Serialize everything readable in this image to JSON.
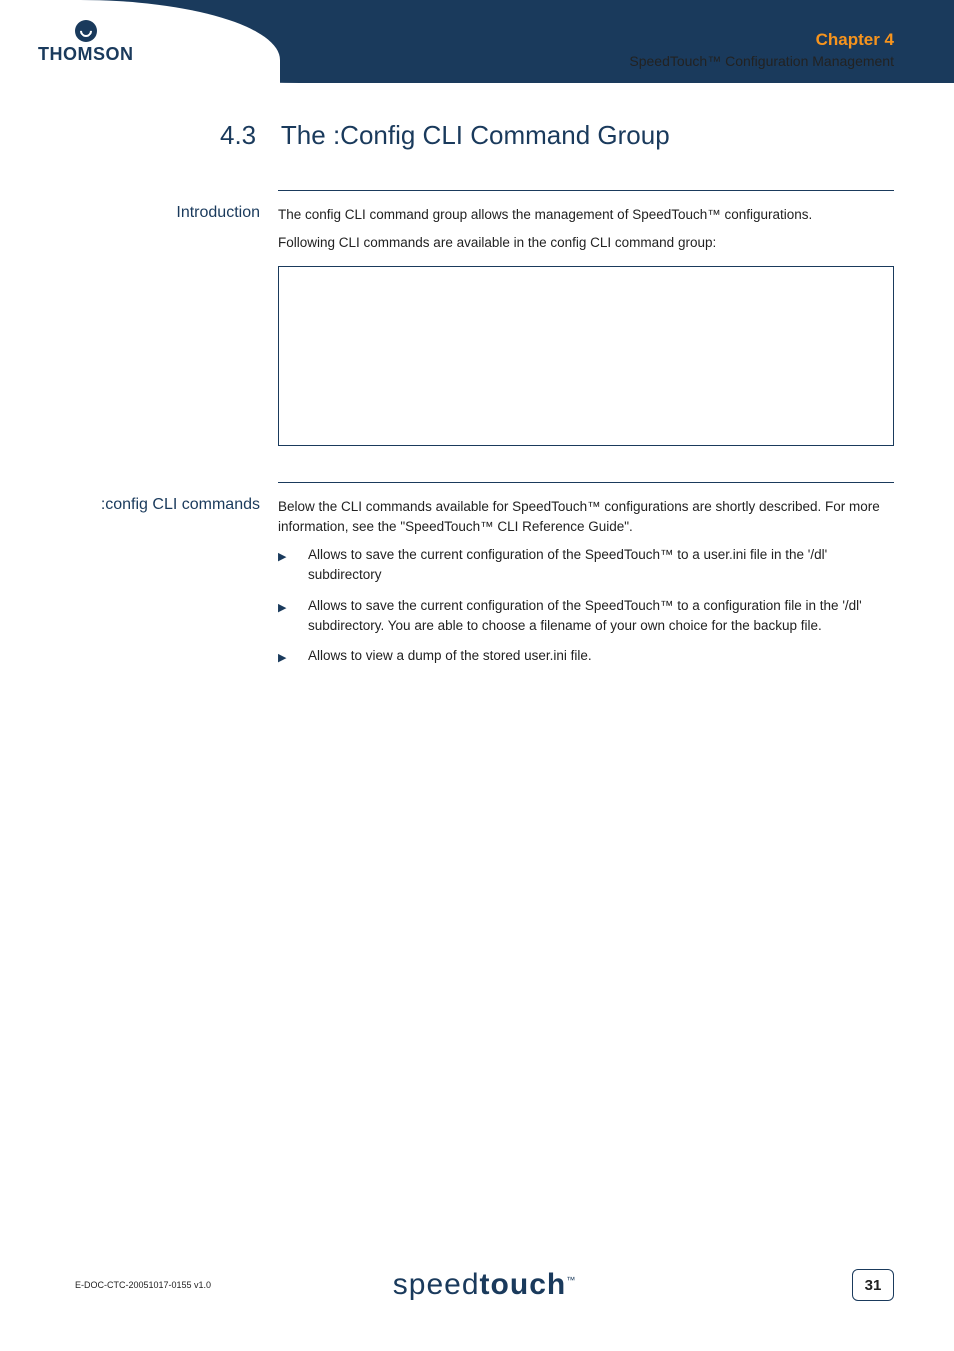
{
  "header": {
    "brand": "THOMSON",
    "chapter_title": "Chapter 4",
    "chapter_sub": "SpeedTouch™ Configuration Management"
  },
  "heading": {
    "number": "4.3",
    "title": "The :Config CLI Command Group"
  },
  "sections": {
    "intro": {
      "label": "Introduction",
      "p1": "The config CLI command group allows the management of SpeedTouch™ configurations.",
      "p2": "Following CLI commands are available in the config CLI command group:"
    },
    "commands": {
      "label": ":config CLI commands",
      "intro": "Below the CLI commands available for SpeedTouch™ configurations are shortly described. For more information, see the \"SpeedTouch™ CLI Reference Guide\".",
      "items": [
        "Allows to save the current configuration of the SpeedTouch™ to a user.ini file in the '/dl' subdirectory",
        "Allows to save the current configuration of the SpeedTouch™ to a configuration file in the '/dl' subdirectory. You are able to choose a filename of your own choice for the backup file.",
        "Allows to view a dump of the stored user.ini file."
      ]
    }
  },
  "footer": {
    "doc_id": "E-DOC-CTC-20051017-0155 v1.0",
    "logo_light": "speed",
    "logo_bold": "touch",
    "tm": "™",
    "page": "31"
  }
}
